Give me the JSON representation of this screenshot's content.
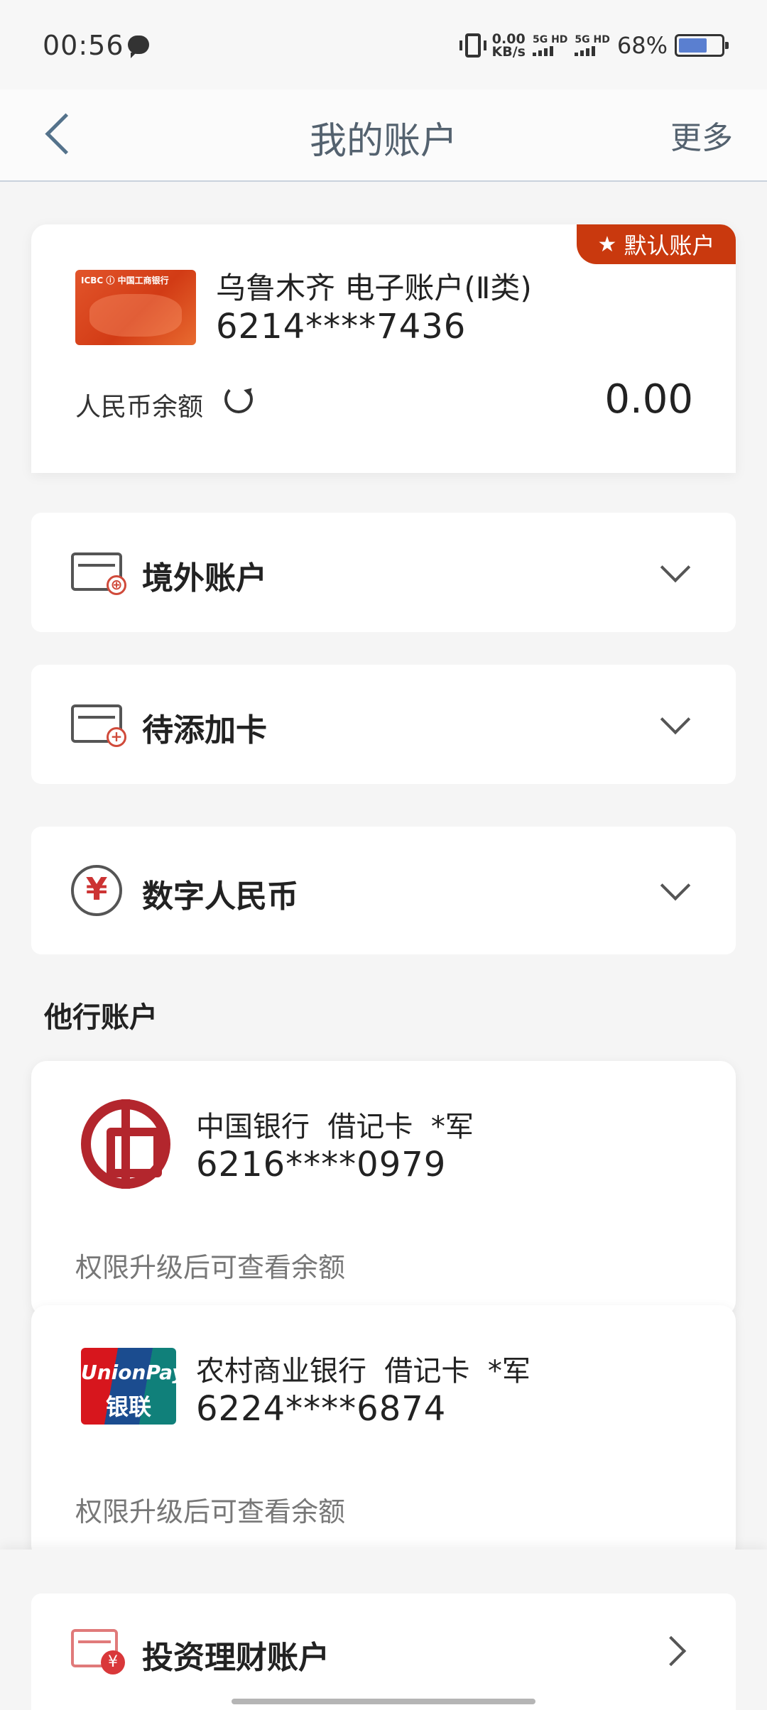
{
  "status_bar": {
    "time": "00:56",
    "net_speed_value": "0.00",
    "net_speed_unit": "KB/s",
    "sim1_label": "5G HD",
    "sim2_label": "5G HD",
    "battery_percent": "68%",
    "battery_level": 0.68
  },
  "header": {
    "title": "我的账户",
    "more_label": "更多"
  },
  "primary_account": {
    "badge_label": "默认账户",
    "card_brand_text": "ICBC ⓘ 中国工商银行",
    "account_name": "乌鲁木齐 电子账户(Ⅱ类)",
    "account_number": "6214****7436",
    "balance_label": "人民币余额",
    "balance_value": "0.00"
  },
  "sections": {
    "overseas": "境外账户",
    "pending_cards": "待添加卡",
    "digital_rmb": "数字人民币"
  },
  "other_banks": {
    "heading": "他行账户",
    "items": [
      {
        "bank": "中国银行  借记卡  *军",
        "number": "6216****0979",
        "note": "权限升级后可查看余额"
      },
      {
        "bank": "农村商业银行  借记卡  *军",
        "number": "6224****6874",
        "note": "权限升级后可查看余额",
        "logo_line1": "UnionPay",
        "logo_line2": "银联"
      }
    ]
  },
  "investment": {
    "label": "投资理财账户"
  },
  "colors": {
    "accent_red": "#c9390e",
    "header_text": "#54626f",
    "boc_red": "#b3262d"
  }
}
